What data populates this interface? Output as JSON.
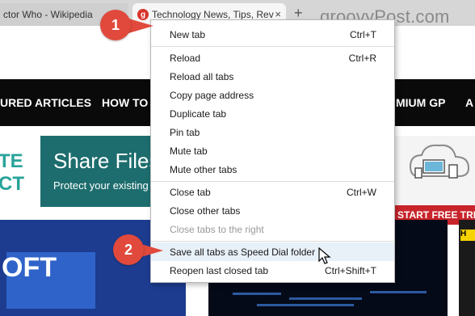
{
  "tabs": [
    {
      "title": "ctor Who - Wikipedia",
      "active": false
    },
    {
      "title": "Technology News, Tips, Rev",
      "active": true,
      "favicon_letter": "g"
    }
  ],
  "tab_close_glyph": "×",
  "new_tab_glyph": "+",
  "watermark": "groovyPost.com",
  "site_nav": [
    "URED ARTICLES",
    "HOW TO",
    "MIUM GP",
    "A"
  ],
  "banner": {
    "logo_top": "TE",
    "logo_bottom": "CT",
    "title": "Share Files",
    "subtitle": "Protect your existing",
    "cta": "START FREE TRIA"
  },
  "image_left_text": "OFT",
  "image_right_badge": "H",
  "context_menu": {
    "items": [
      {
        "label": "New tab",
        "shortcut": "Ctrl+T"
      },
      {
        "label": "Reload",
        "shortcut": "Ctrl+R"
      },
      {
        "label": "Reload all tabs",
        "shortcut": ""
      },
      {
        "label": "Copy page address",
        "shortcut": ""
      },
      {
        "label": "Duplicate tab",
        "shortcut": ""
      },
      {
        "label": "Pin tab",
        "shortcut": ""
      },
      {
        "label": "Mute tab",
        "shortcut": ""
      },
      {
        "label": "Mute other tabs",
        "shortcut": ""
      },
      {
        "label": "Close tab",
        "shortcut": "Ctrl+W"
      },
      {
        "label": "Close other tabs",
        "shortcut": ""
      },
      {
        "label": "Close tabs to the right",
        "shortcut": "",
        "disabled": true
      },
      {
        "label": "Save all tabs as Speed Dial folder",
        "shortcut": "",
        "highlighted": true
      },
      {
        "label": "Reopen last closed tab",
        "shortcut": "Ctrl+Shift+T"
      }
    ]
  },
  "callouts": [
    {
      "number": "1"
    },
    {
      "number": "2"
    }
  ],
  "colors": {
    "callout": "#e0493c",
    "favicon": "#d8352a",
    "banner_teal": "#1e6d6e",
    "cta_red": "#c8242b"
  },
  "icons": {
    "cursor": "arrow-cursor-icon",
    "favicon": "groovypost-favicon-icon",
    "cloud": "cloud-devices-icon"
  }
}
